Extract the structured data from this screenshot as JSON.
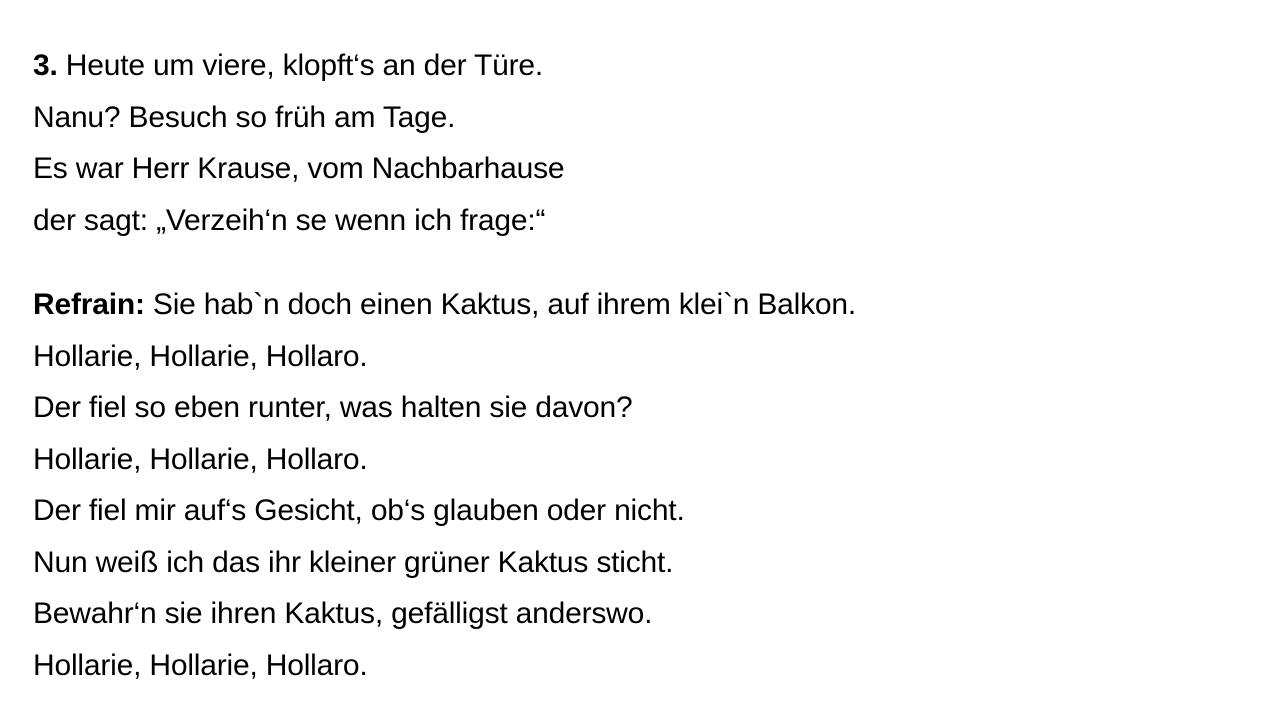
{
  "verse": {
    "number": "3.",
    "lines": [
      " Heute um viere, klopft‘s an der Türe.",
      "Nanu? Besuch so früh am Tage.",
      "Es war Herr Krause, vom Nachbarhause",
      "der sagt: „Verzeih‘n se wenn ich frage:“"
    ]
  },
  "refrain": {
    "label": "Refrain:",
    "lines": [
      " Sie hab`n doch einen Kaktus, auf ihrem klei`n Balkon.",
      "Hollarie, Hollarie, Hollaro.",
      "Der fiel so eben runter, was halten sie davon?",
      "Hollarie, Hollarie, Hollaro.",
      "Der fiel mir auf‘s Gesicht, ob‘s glauben oder nicht.",
      "Nun weiß ich das ihr kleiner grüner Kaktus sticht.",
      "Bewahr‘n sie ihren Kaktus, gefälligst anderswo.",
      "Hollarie, Hollarie, Hollaro."
    ]
  }
}
